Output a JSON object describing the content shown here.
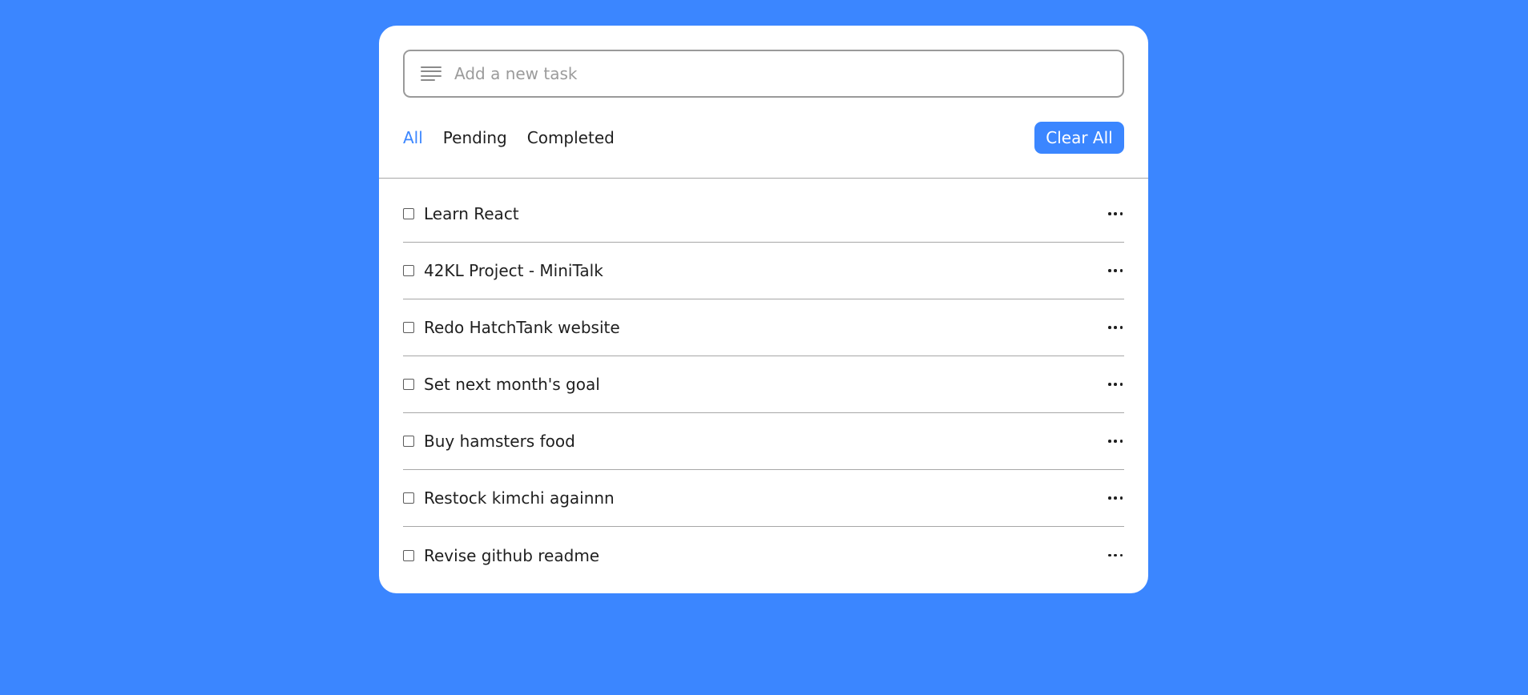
{
  "input": {
    "placeholder": "Add a new task",
    "value": ""
  },
  "filters": [
    {
      "label": "All",
      "active": true
    },
    {
      "label": "Pending",
      "active": false
    },
    {
      "label": "Completed",
      "active": false
    }
  ],
  "clear_button": {
    "label": "Clear All"
  },
  "tasks": [
    {
      "label": "Learn React",
      "checked": false
    },
    {
      "label": "42KL Project - MiniTalk",
      "checked": false
    },
    {
      "label": "Redo HatchTank website",
      "checked": false
    },
    {
      "label": "Set next month's goal",
      "checked": false
    },
    {
      "label": "Buy hamsters food",
      "checked": false
    },
    {
      "label": "Restock kimchi againnn",
      "checked": false
    },
    {
      "label": "Revise github readme",
      "checked": false
    }
  ],
  "icons": {
    "input_icon": "text-lines-icon",
    "task_menu_icon": "more-horizontal-icon"
  },
  "colors": {
    "background": "#3b86ff",
    "accent": "#3b86ff",
    "card": "#ffffff"
  }
}
